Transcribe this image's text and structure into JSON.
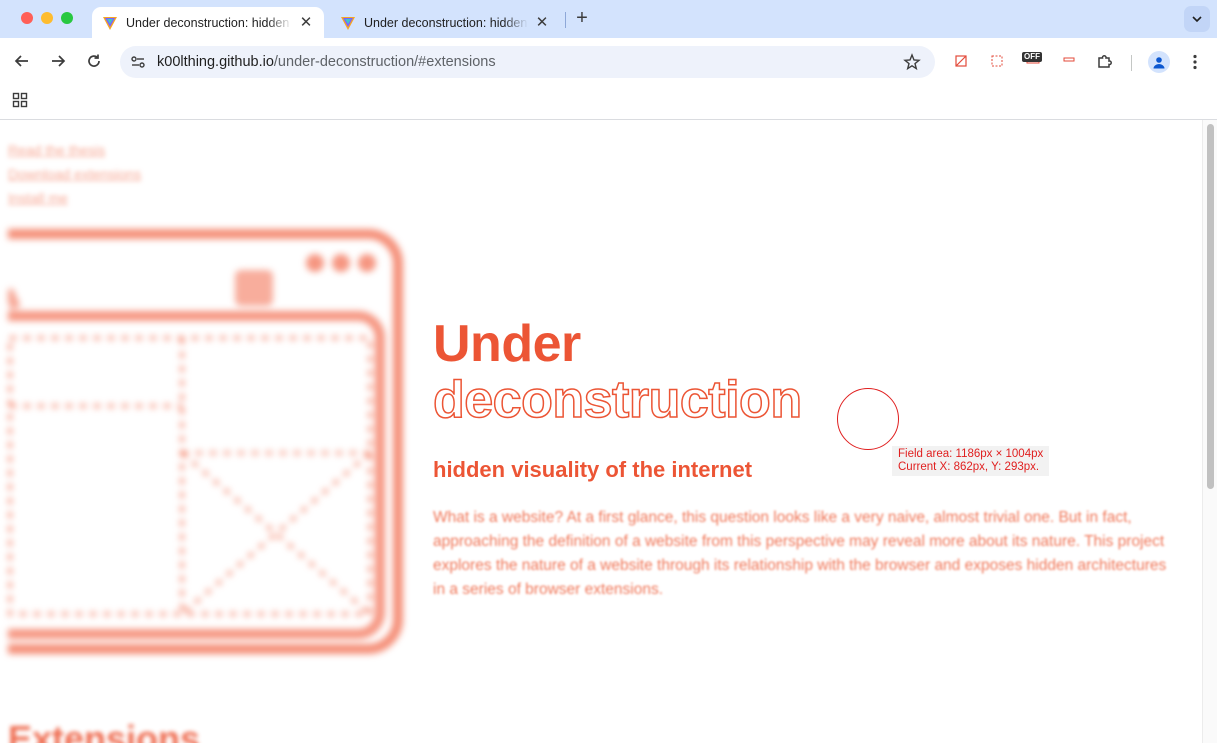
{
  "browser": {
    "tabs": [
      {
        "title": "Under deconstruction: hidden visuality of the internet",
        "active": true
      },
      {
        "title": "Under deconstruction: hidden visuality of the internet",
        "active": false
      }
    ],
    "address": {
      "host": "k00lthing.github.io",
      "path": "/under-deconstruction/#extensions"
    },
    "extension_badge": "OFF"
  },
  "page": {
    "nav_links": [
      "Read the thesis",
      "Download extensions",
      "Install me"
    ],
    "hero": {
      "title_line1": "Under",
      "title_line2": "deconstruction",
      "subtitle": "hidden visuality of the internet",
      "body": "What is a website? At a first glance, this question looks like a very naive, almost trivial one. But in fact, approaching the definition of a website from this perspective may reveal more about its nature. This project explores the nature of a website through its relationship with the browser and exposes hidden architectures in a series of browser extensions."
    },
    "next_section_heading": "Extensions"
  },
  "overlay": {
    "field_area": "Field area: 1186px × 1004px",
    "current": "Current X: 862px, Y: 293px."
  },
  "colors": {
    "accent": "#ec5535",
    "chrome_tabbar": "#d3e3fd",
    "overlay_red": "#e01f1f"
  }
}
